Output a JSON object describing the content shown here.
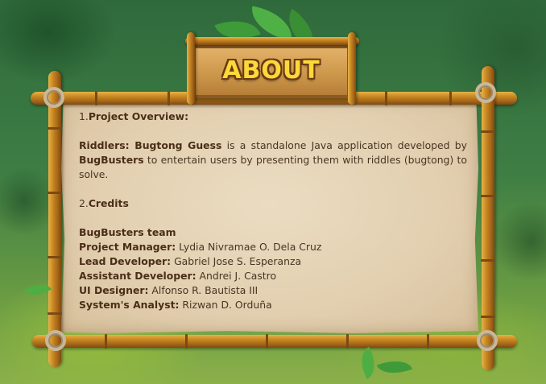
{
  "header": {
    "title": "ABOUT"
  },
  "overview": {
    "number": "1.",
    "heading": "Project Overview:",
    "app_name": "Riddlers: Bugtong Guess",
    "text1": " is a standalone Java application developed by ",
    "team_name": "BugBusters",
    "text2": " to entertain users by presenting them with riddles (bugtong) to solve."
  },
  "credits": {
    "number": "2.",
    "heading": "Credits",
    "team_heading": "BugBusters team",
    "members": [
      {
        "role": "Project Manager:",
        "name": " Lydia Nivramae O. Dela Cruz"
      },
      {
        "role": "Lead Developer:",
        "name": " Gabriel Jose S. Esperanza"
      },
      {
        "role": "Assistant Developer:",
        "name": " Andrei J. Castro"
      },
      {
        "role": "UI Designer:",
        "name": " Alfonso R. Bautista III"
      },
      {
        "role": "System's Analyst:",
        "name": " Rizwan D. Orduña"
      }
    ]
  },
  "colors": {
    "title_fill": "#fbd93a",
    "title_outline": "#6b3a12",
    "text": "#4a3422",
    "paper": "#e2cfb0",
    "bamboo": "#c98a22"
  },
  "icons": {
    "leaves": "jungle-leaf-decoration",
    "rope": "rope-knot"
  }
}
